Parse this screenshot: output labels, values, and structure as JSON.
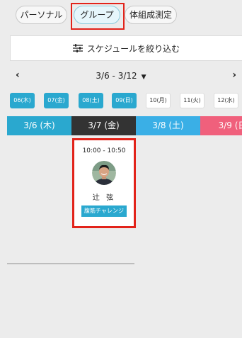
{
  "categories": [
    {
      "label": "パーソナル",
      "selected": false
    },
    {
      "label": "グループ",
      "selected": true
    },
    {
      "label": "体組成測定",
      "selected": false
    }
  ],
  "filter": {
    "label": "スケジュールを絞り込む",
    "icon": "sliders-icon"
  },
  "week_nav": {
    "prev": "‹",
    "range": "3/6 - 3/12",
    "dropdown": "▼",
    "next": "›"
  },
  "day_chips": [
    {
      "label": "06(木)",
      "active": true
    },
    {
      "label": "07(金)",
      "active": true
    },
    {
      "label": "08(土)",
      "active": true
    },
    {
      "label": "09(日)",
      "active": true
    },
    {
      "label": "10(月)",
      "active": false
    },
    {
      "label": "11(火)",
      "active": false
    },
    {
      "label": "12(水)",
      "active": false
    }
  ],
  "day_headers": [
    {
      "label": "3/6 (木)",
      "color": "#2aa8cf"
    },
    {
      "label": "3/7 (金)",
      "color": "#333333"
    },
    {
      "label": "3/8 (土)",
      "color": "#3aafe6"
    },
    {
      "label": "3/9 (日",
      "color": "#f0607c"
    }
  ],
  "lesson": {
    "time": "10:00 - 10:50",
    "trainer": "辻 弦",
    "tag": "腹筋チャレンジ"
  },
  "colors": {
    "accent": "#2aa8cf",
    "highlight": "#e2231a"
  }
}
